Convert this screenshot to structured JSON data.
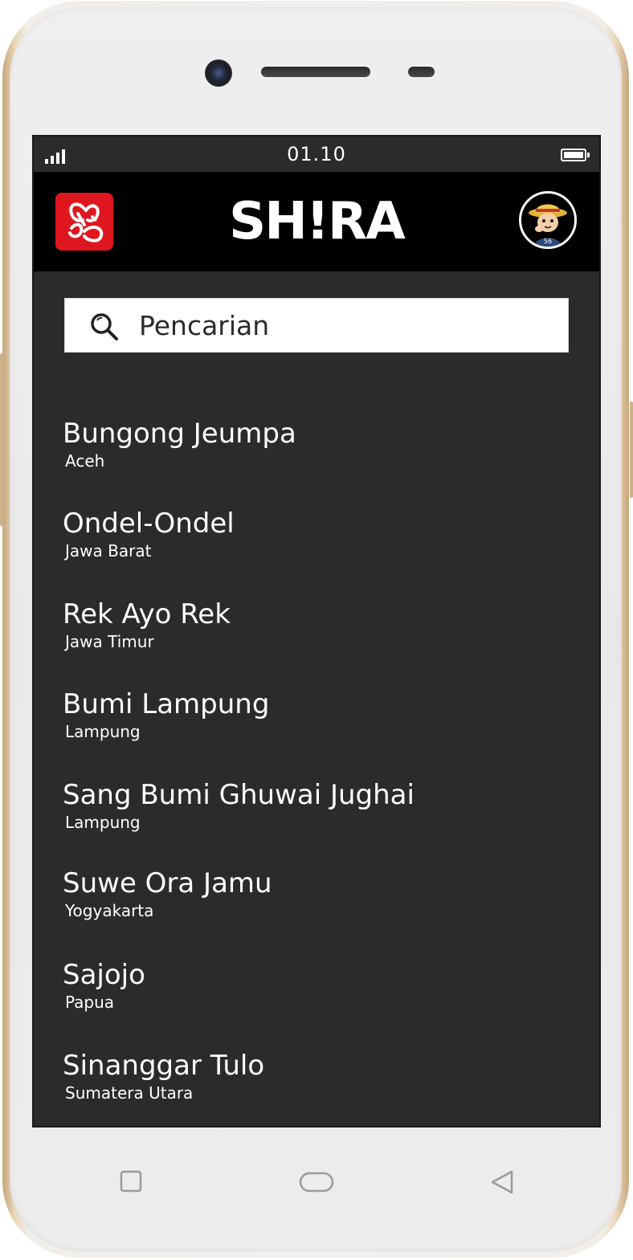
{
  "status_bar": {
    "time": "01.10"
  },
  "header": {
    "title": "SH!RA"
  },
  "search": {
    "placeholder": "Pencarian"
  },
  "songs": [
    {
      "title": "Bungong Jeumpa",
      "region": "Aceh"
    },
    {
      "title": "Ondel-Ondel",
      "region": "Jawa Barat"
    },
    {
      "title": "Rek Ayo Rek",
      "region": "Jawa Timur"
    },
    {
      "title": "Bumi Lampung",
      "region": "Lampung"
    },
    {
      "title": "Sang Bumi Ghuwai Jughai",
      "region": "Lampung"
    },
    {
      "title": "Suwe Ora Jamu",
      "region": "Yogyakarta"
    },
    {
      "title": "Sajojo",
      "region": "Papua"
    },
    {
      "title": "Sinanggar Tulo",
      "region": "Sumatera Utara"
    }
  ],
  "icons": {
    "app_logo": "butterfly-logo-icon",
    "avatar": "cartoon-avatar",
    "search": "search-icon",
    "nav": [
      "recent-apps-icon",
      "home-icon",
      "back-icon"
    ]
  },
  "colors": {
    "screen_bg": "#2b2b2b",
    "header_bg": "#000000",
    "logo_red": "#e0161e",
    "text": "#ffffff"
  }
}
